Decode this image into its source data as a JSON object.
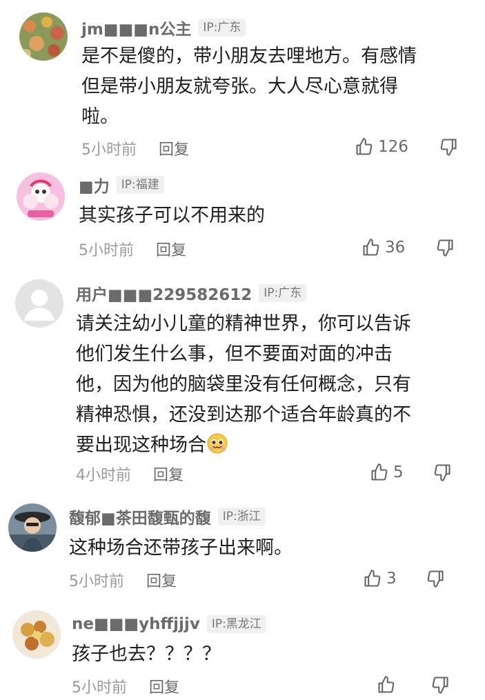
{
  "comments": [
    {
      "username": "jm■■■n公主",
      "ip": "IP:广东",
      "lines": [
        "是不是傻的，带小朋友去哩地方。有感情",
        "但是带小朋友就夸张。大人尽心意就得",
        "啦。"
      ],
      "time": "5小时前",
      "reply": "回复",
      "likes": "126",
      "avatar": "flower-field-avatar"
    },
    {
      "username": "■力",
      "ip": "IP:福建",
      "lines": [
        "其实孩子可以不用来的"
      ],
      "time": "5小时前",
      "reply": "回复",
      "likes": "36",
      "avatar": "powerpuff-girls-avatar"
    },
    {
      "username": "用户■■■229582612",
      "ip": "IP:广东",
      "lines": [
        "请关注幼小儿童的精神世界，你可以告诉",
        "他们发生什么事，但不要面对面的冲击",
        "他，因为他的脑袋里没有任何概念，只有",
        "精神恐惧，还没到达那个适合年龄真的不",
        "要出现这种场合"
      ],
      "emoji": "pleading-face-emoji",
      "time": "4小时前",
      "reply": "回复",
      "likes": "5",
      "avatar": "default-user-avatar"
    },
    {
      "username": "馥郁■茶田馥甄的馥",
      "ip": "IP:浙江",
      "lines": [
        "这种场合还带孩子出来啊。"
      ],
      "time": "5小时前",
      "reply": "回复",
      "likes": "3",
      "avatar": "woman-with-hat-avatar"
    },
    {
      "username": "ne■■■yhffjjjv",
      "ip": "IP:黑龙江",
      "lines": [
        "孩子也去？？？？"
      ],
      "time": "5小时前",
      "reply": "回复",
      "likes": "",
      "avatar": "food-dish-avatar"
    }
  ],
  "icons": {
    "like": "thumbs-up-icon",
    "dislike": "thumbs-down-icon"
  },
  "colors": {
    "username": "#6b6b6b",
    "text": "#1e1e1e",
    "meta": "#9a9a9a",
    "badge_bg": "#f0f0f0"
  }
}
